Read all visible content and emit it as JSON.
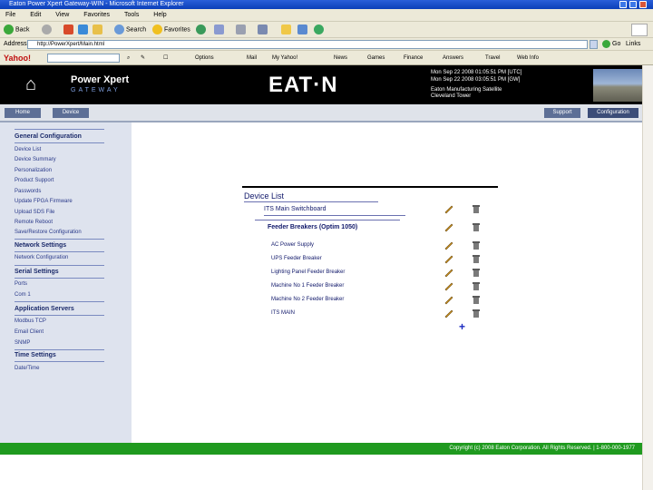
{
  "browser": {
    "title": "Eaton Power Xpert Gateway-WIN - Microsoft Internet Explorer",
    "menu": [
      "File",
      "Edit",
      "View",
      "Favorites",
      "Tools",
      "Help"
    ],
    "toolbar": {
      "back": "Back",
      "search": "Search",
      "favorites": "Favorites"
    },
    "address_label": "Address",
    "address_value": "http://PowerXpert/Main.html",
    "go": "Go",
    "links": "Links",
    "yahoo_items": [
      "Yahoo!",
      "Options",
      "Mail",
      "My Yahoo!",
      "News",
      "Games",
      "Finance",
      "Answers",
      "Travel",
      "Web Info"
    ]
  },
  "banner": {
    "product": "Power Xpert",
    "product_sub": "GATEWAY",
    "brand": "EAT·N",
    "time_line1": "Mon Sep 22 2008 01:05:51 PM [UTC]",
    "time_line2": "Mon Sep 22 2008 03:05:51 PM [GW]",
    "site_line1": "Eaton Manufacturing Satellite",
    "site_line2": "Cleveland Tower"
  },
  "nav": {
    "home": "Home",
    "device": "Device",
    "support": "Support",
    "configuration": "Configuration"
  },
  "sidebar": {
    "sections": [
      {
        "title": "General Configuration",
        "items": [
          "Device List",
          "Device Summary",
          "Personalization",
          "Product Support",
          "Passwords",
          "Update FPGA Firmware",
          "Upload SDS File",
          "Remote Reboot",
          "Save/Restore Configuration"
        ]
      },
      {
        "title": "Network Settings",
        "items": [
          "Network Configuration"
        ]
      },
      {
        "title": "Serial Settings",
        "items": [
          "Ports",
          "Com 1"
        ]
      },
      {
        "title": "Application Servers",
        "items": [
          "Modbus TCP",
          "Email Client",
          "SNMP"
        ]
      },
      {
        "title": "Time Settings",
        "items": [
          "Date/Time"
        ]
      }
    ]
  },
  "device_list": {
    "title": "Device List",
    "top": "ITS Main Switchboard",
    "group": "Feeder Breakers (Optim 1050)",
    "devices": [
      "AC Power Supply",
      "UPS Feeder Breaker",
      "Lighting Panel Feeder Breaker",
      "Machine No 1 Feeder Breaker",
      "Machine No 2 Feeder Breaker",
      "ITS MAIN"
    ],
    "add": "+"
  },
  "footer": "Copyright (c) 2008 Eaton Corporation. All Rights Reserved. | 1-800-000-1977"
}
